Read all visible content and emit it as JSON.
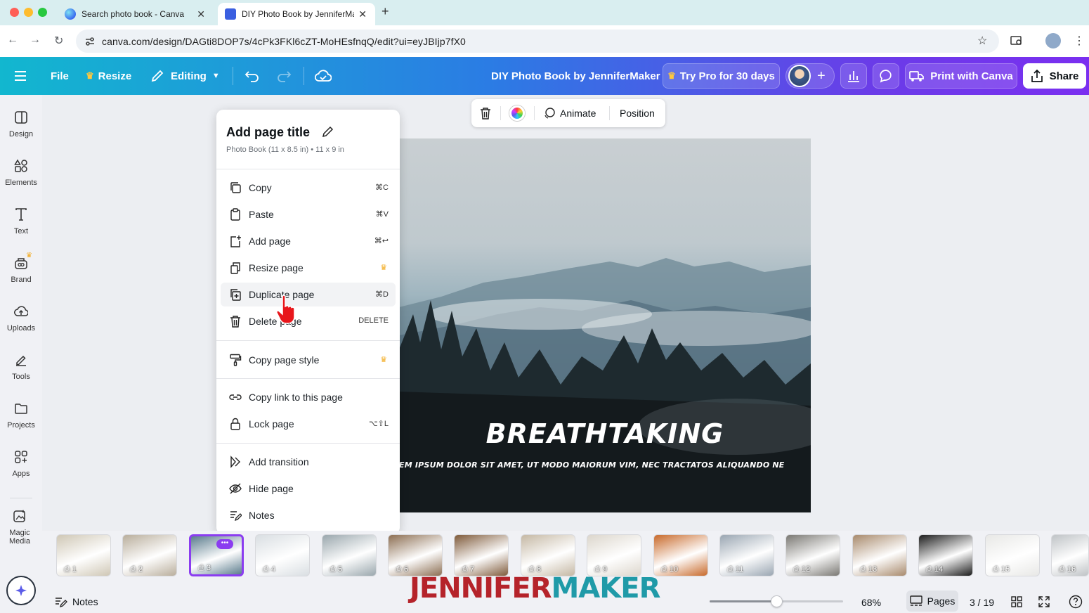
{
  "browser": {
    "tabs": [
      {
        "title": "Search photo book - Canva",
        "active": false
      },
      {
        "title": "DIY Photo Book by JenniferMaker",
        "active": true
      }
    ],
    "url": "canva.com/design/DAGti8DOP7s/4cPk3FKl6cZT-MoHEsfnqQ/edit?ui=eyJBIjp7fX0"
  },
  "header": {
    "file": "File",
    "resize": "Resize",
    "editing": "Editing",
    "doc_title": "DIY Photo Book by JenniferMaker",
    "try_pro": "Try Pro for 30 days",
    "print": "Print with Canva",
    "share": "Share"
  },
  "sidebar": {
    "items": [
      "Design",
      "Elements",
      "Text",
      "Brand",
      "Uploads",
      "Tools",
      "Projects",
      "Apps",
      "Magic Media"
    ]
  },
  "floating_toolbar": {
    "animate": "Animate",
    "position": "Position"
  },
  "context_menu": {
    "title": "Add page title",
    "subtitle": "Photo Book (11 x 8.5 in) • 11 x 9 in",
    "items": [
      {
        "label": "Copy",
        "shortcut": "⌘C",
        "icon": "copy-icon"
      },
      {
        "label": "Paste",
        "shortcut": "⌘V",
        "icon": "paste-icon"
      },
      {
        "label": "Add page",
        "shortcut": "⌘↩",
        "icon": "add-page-icon"
      },
      {
        "label": "Resize page",
        "shortcut": "",
        "icon": "resize-icon",
        "pro": true
      },
      {
        "label": "Duplicate page",
        "shortcut": "⌘D",
        "icon": "duplicate-icon"
      },
      {
        "label": "Delete page",
        "shortcut": "DELETE",
        "icon": "trash-icon"
      },
      {
        "label": "Copy page style",
        "shortcut": "",
        "icon": "paint-roller-icon",
        "pro": true
      },
      {
        "label": "Copy link to this page",
        "shortcut": "",
        "icon": "link-icon"
      },
      {
        "label": "Lock page",
        "shortcut": "⌥⇧L",
        "icon": "lock-icon"
      },
      {
        "label": "Add transition",
        "shortcut": "",
        "icon": "transition-icon"
      },
      {
        "label": "Hide page",
        "shortcut": "",
        "icon": "eye-off-icon"
      },
      {
        "label": "Notes",
        "shortcut": "",
        "icon": "notes-icon"
      }
    ]
  },
  "canvas": {
    "headline": "BREATHTAKING",
    "body": "EM IPSUM DOLOR SIT AMET, UT MODO MAIORUM VIM, NEC TRACTATOS ALIQUANDO NE"
  },
  "thumbnails": {
    "pages": [
      "1",
      "2",
      "3",
      "4",
      "5",
      "6",
      "7",
      "8",
      "9",
      "10",
      "11",
      "12",
      "13",
      "14",
      "15",
      "16"
    ],
    "selected": 3,
    "colors": [
      "#cfc7b5",
      "#b9ae9c",
      "#5c7d8e",
      "#d9dee2",
      "#9aa7ad",
      "#8c6e52",
      "#7f5a3a",
      "#c5b8a4",
      "#dcd6cc",
      "#c86a2b",
      "#9aa6b2",
      "#7a7873",
      "#a88a6c",
      "#1c1c1c",
      "#e8e8e6",
      "#bfc3c6"
    ]
  },
  "bottom": {
    "notes": "Notes",
    "zoom": "68%",
    "zoom_level": 0.68,
    "pages": "Pages",
    "page_count": "3 / 19"
  },
  "watermark": {
    "part1": "JENNIFER",
    "part2": "MAKER",
    "color1": "#b5232a",
    "color2": "#1f9aa8"
  },
  "colors": {
    "accent": "#8b3df0",
    "header_start": "#12b7cf",
    "header_end": "#7a2ff0"
  }
}
